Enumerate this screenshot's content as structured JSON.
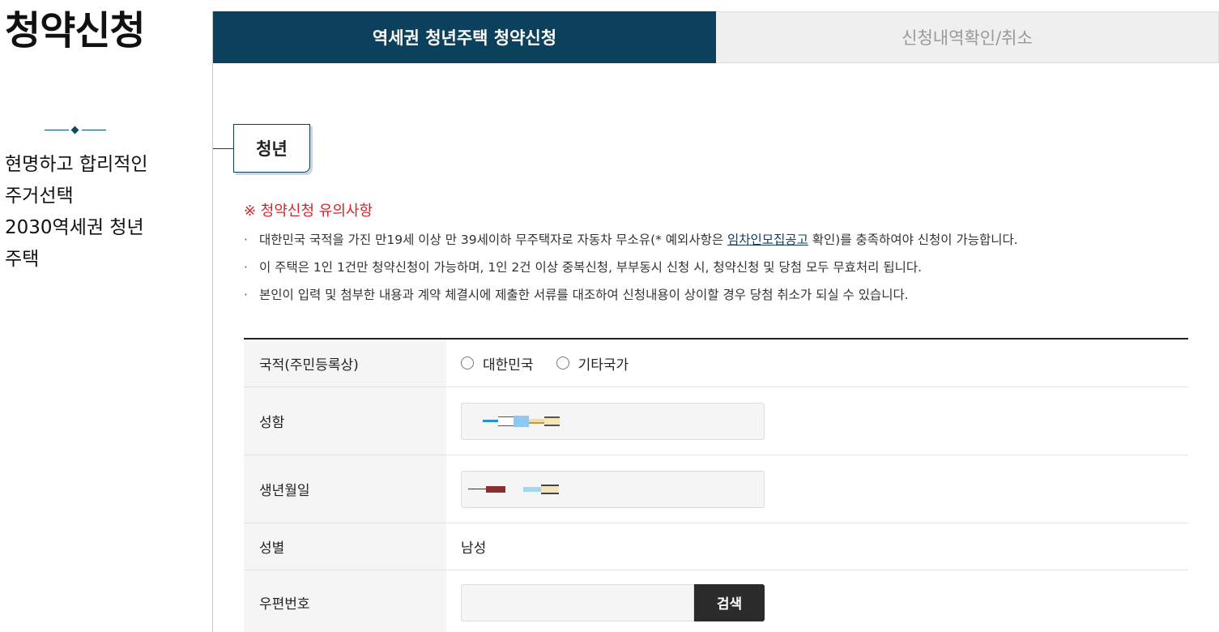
{
  "sidebar": {
    "title": "청약신청",
    "slogan": [
      "현명하고 합리적인",
      "주거선택",
      "2030역세권 청년",
      "주택"
    ]
  },
  "tabs": [
    {
      "label": "역세권 청년주택 청약신청",
      "active": true
    },
    {
      "label": "신청내역확인/취소",
      "active": false
    }
  ],
  "section": {
    "label": "청년"
  },
  "notice": {
    "title": "※ 청약신청 유의사항",
    "bullet": "·",
    "item1_before": "대한민국 국적을 가진 만19세 이상 만 39세이하 무주택자로 자동차 무소유(* 예외사항은 ",
    "item1_link": "임차인모집공고",
    "item1_after": " 확인)를 충족하여야 신청이 가능합니다.",
    "item2": "이 주택은 1인 1건만 청약신청이 가능하며, 1인 2건 이상 중복신청, 부부동시 신청 시, 청약신청 및 당첨 모두 무효처리 됩니다.",
    "item3": "본인이 입력 및 첨부한 내용과 계약 체결시에 제출한 서류를 대조하여 신청내용이 상이할 경우 당첨 취소가 되실 수 있습니다."
  },
  "form": {
    "nationality": {
      "label": "국적(주민등록상)",
      "options": [
        "대한민국",
        "기타국가"
      ]
    },
    "name": {
      "label": "성함"
    },
    "birth": {
      "label": "생년월일"
    },
    "gender": {
      "label": "성별",
      "value": "남성"
    },
    "zipcode": {
      "label": "우편번호",
      "button": "검색"
    }
  },
  "colors": {
    "primary": "#0c415d",
    "notice": "#d3222a",
    "button": "#2b2b2b"
  }
}
